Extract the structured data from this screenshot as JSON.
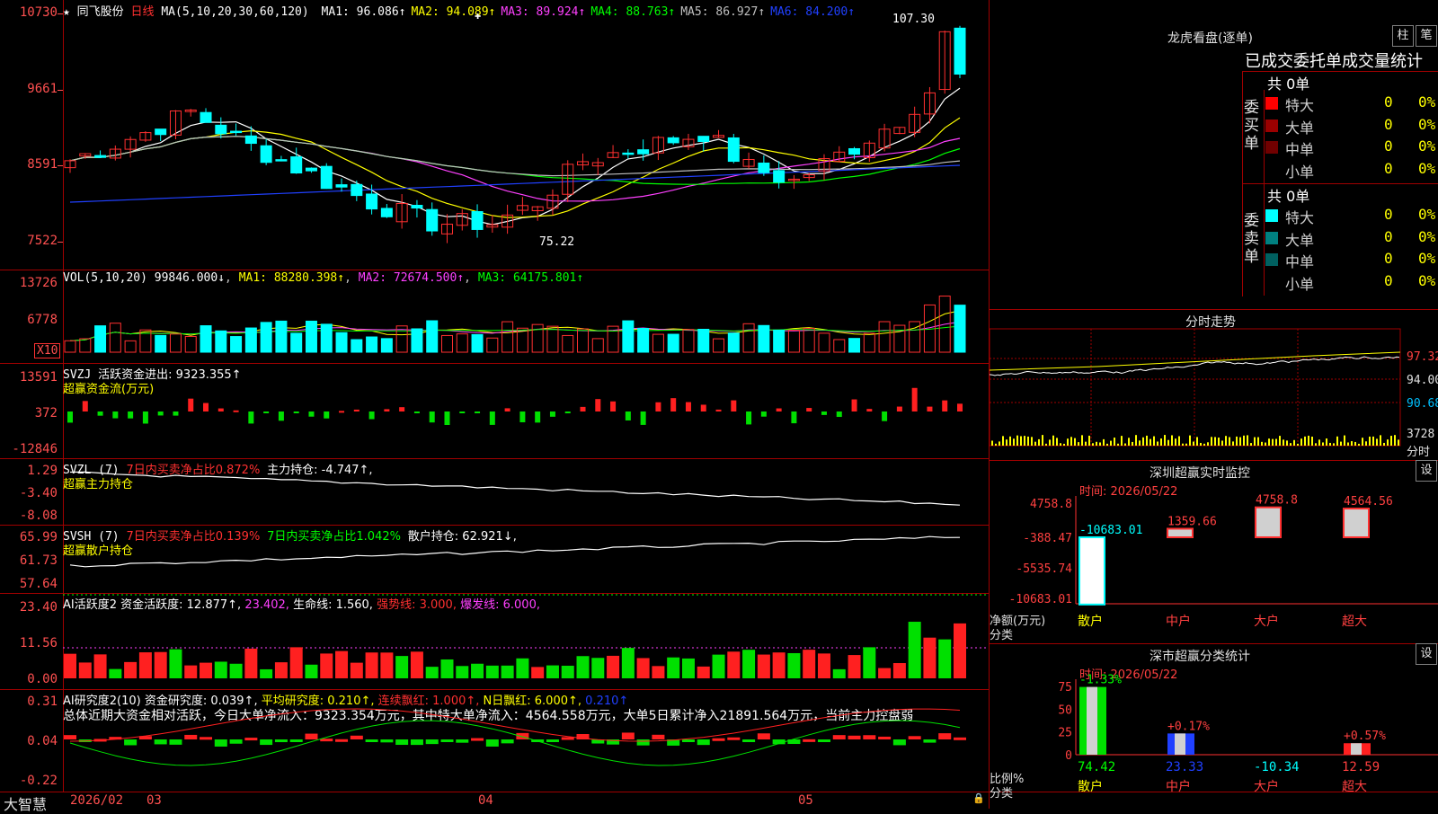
{
  "main": {
    "stock_name": "同飞股份",
    "period": "日线",
    "ma_label": "MA(5,10,20,30,60,120)",
    "ma": [
      {
        "label": "MA1: 96.086↑",
        "color": "#ffffff"
      },
      {
        "label": "MA2: 94.089↑",
        "color": "#ffff00"
      },
      {
        "label": "MA3: 89.924↑",
        "color": "#ff40ff"
      },
      {
        "label": "MA4: 88.763↑",
        "color": "#00ff00"
      },
      {
        "label": "MA5: 86.927↑",
        "color": "#c0c0c0"
      },
      {
        "label": "MA6: 84.200↑",
        "color": "#2040ff"
      }
    ],
    "y_labels": [
      "10730",
      "9661",
      "8591",
      "7522"
    ],
    "high_note": "107.30",
    "low_note": "75.22"
  },
  "vol": {
    "header": "VOL(5,10,20)",
    "value": "99846.000↓",
    "ma1": "MA1: 88280.398↑",
    "ma2": "MA2: 72674.500↑",
    "ma3": "MA3: 64175.801↑",
    "y_labels": [
      "13726",
      "6778"
    ],
    "unit": "X10"
  },
  "svzj": {
    "header": "SVZJ",
    "text": "活跃资金进出: 9323.355↑",
    "sub": "超赢资金流(万元)",
    "y_labels": [
      "13591",
      "372",
      "-12846"
    ]
  },
  "svzl": {
    "header": "SVZL (7)",
    "t1": "7日内买卖净占比0.872%",
    "t2": "主力持仓: -4.747↑,",
    "sub": "超赢主力持仓",
    "y_labels": [
      "1.29",
      "-3.40",
      "-8.08"
    ]
  },
  "svsh": {
    "header": "SVSH (7)",
    "t1": "7日内买卖净占比0.139%",
    "t2": "7日内买卖净占比1.042%",
    "t3": "散户持仓: 62.921↓,",
    "sub": "超赢散户持仓",
    "y_labels": [
      "65.99",
      "61.73",
      "57.64"
    ]
  },
  "ai1": {
    "header": "AI活跃度2",
    "t1": "资金活跃度: 12.877↑,",
    "t2": "23.402,",
    "t3": "生命线: 1.560,",
    "t4": "强势线: 3.000,",
    "t5": "爆发线: 6.000,",
    "y_labels": [
      "23.40",
      "11.56",
      "0.00"
    ]
  },
  "ai2": {
    "header": "AI研究度2(10)",
    "t1": "资金研究度: 0.039↑,",
    "t2": "平均研究度: 0.210↑,",
    "t3": "连续飘红: 1.000↑,",
    "t4": "N日飘红: 6.000↑,",
    "t5": "0.210↑",
    "summary": "总体近期大资金相对活跃，今日大单净流入：9323.354万元，其中特大单净流入：4564.558万元，大单5日累计净入21891.564万元，当前主力控盘弱",
    "y_labels": [
      "0.31",
      "0.04",
      "-0.22"
    ]
  },
  "bottom": {
    "brand": "大智慧",
    "dates": [
      "2026/02",
      "03",
      "04",
      "05"
    ]
  },
  "dragon": {
    "title": "龙虎看盘(逐单)",
    "btn1": "柱",
    "btn2": "笔",
    "stats_title": "已成交委托单成交量统计",
    "buy_label": "委买单",
    "sell_label": "委卖单",
    "buy_total": "共 0单",
    "sell_total": "共 0单",
    "buy_rows": [
      {
        "label": "特大",
        "v": "0",
        "p": "0%",
        "color": "#ff0000"
      },
      {
        "label": "大单",
        "v": "0",
        "p": "0%",
        "color": "#9b0000"
      },
      {
        "label": "中单",
        "v": "0",
        "p": "0%",
        "color": "#700000"
      },
      {
        "label": "小单",
        "v": "0",
        "p": "0%",
        "color": "#000000"
      }
    ],
    "sell_rows": [
      {
        "label": "特大",
        "v": "0",
        "p": "0%",
        "color": "#00ffff"
      },
      {
        "label": "大单",
        "v": "0",
        "p": "0%",
        "color": "#008080"
      },
      {
        "label": "中单",
        "v": "0",
        "p": "0%",
        "color": "#006060"
      },
      {
        "label": "小单",
        "v": "0",
        "p": "0%",
        "color": "#000000"
      }
    ]
  },
  "intraday": {
    "title": "分时走势",
    "labels": [
      "97.32",
      "94.00",
      "90.68",
      "3728"
    ],
    "unit": "分时"
  },
  "sz_monitor": {
    "title": "深圳超赢实时监控",
    "btn": "设",
    "time": "时间: 2026/05/22",
    "y_labels": [
      "4758.8",
      "-388.47",
      "-5535.74",
      "-10683.01"
    ],
    "axis_name1": "净额(万元)",
    "axis_name2": "分类",
    "categories": [
      "散户",
      "中户",
      "大户",
      "超大"
    ],
    "values": [
      "-10683.01",
      "1359.66",
      "4758.8",
      "4564.56"
    ]
  },
  "sz_class": {
    "title": "深市超赢分类统计",
    "btn": "设",
    "time": "时间: 2026/05/22",
    "y_labels": [
      "75",
      "50",
      "25",
      "0"
    ],
    "axis_name1": "比例%",
    "axis_name2": "分类",
    "categories": [
      "散户",
      "中户",
      "大户",
      "超大"
    ],
    "values": [
      "74.42",
      "23.33",
      "-10.34",
      "12.59"
    ],
    "changes": [
      "-1.33%",
      "+0.17%",
      "",
      "+0.57%"
    ]
  }
}
